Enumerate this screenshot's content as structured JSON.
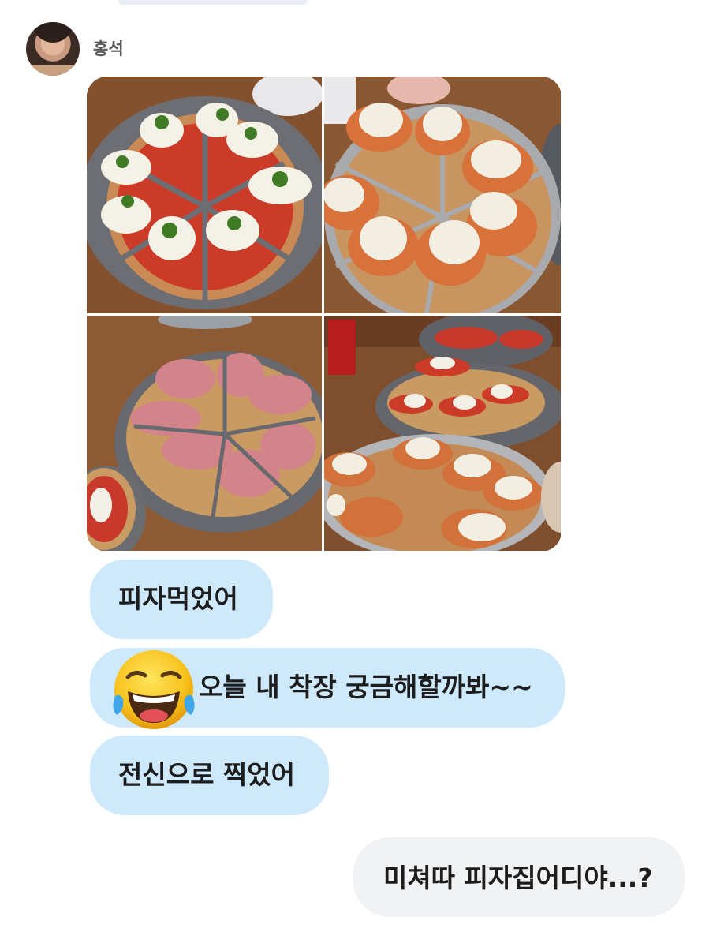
{
  "sender": {
    "name": "홍석"
  },
  "photos": [
    {
      "name": "pizza-tomato-burrata"
    },
    {
      "name": "pizza-orange-burrata"
    },
    {
      "name": "pizza-prosciutto"
    },
    {
      "name": "pizza-multiple-plates"
    }
  ],
  "messages": {
    "incoming": [
      {
        "text": "피자먹었어"
      },
      {
        "text": "오늘 내 착장 궁금해할까봐~~",
        "emoji": "face-with-tears-of-joy-icon"
      },
      {
        "text": "전신으로 찍었어"
      }
    ],
    "outgoing": [
      {
        "text": "미쳐따 피자집어디야...?"
      }
    ]
  },
  "colors": {
    "incoming_bubble": "#cde9fb",
    "outgoing_bubble": "#f0f2f4",
    "sender_name": "#5a5a5a"
  }
}
